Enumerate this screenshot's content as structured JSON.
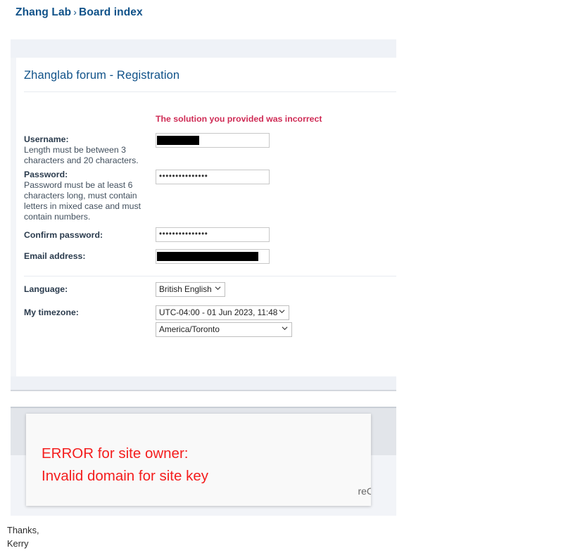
{
  "breadcrumb": {
    "root": "Zhang Lab",
    "separator": "›",
    "current": "Board index"
  },
  "registration_panel": {
    "title": "Zhanglab forum - Registration",
    "error_message": "The solution you provided was incorrect",
    "fields": [
      {
        "label": "Username:",
        "help": "Length must be between 3 characters and 20 characters.",
        "value": "",
        "redacted": true
      },
      {
        "label": "Password:",
        "help": "Password must be at least 6 characters long, must contain letters in mixed case and must contain numbers.",
        "value": "•••••••••••••••",
        "redacted": false
      },
      {
        "label": "Confirm password:",
        "help": "",
        "value": "•••••••••••••••",
        "redacted": false
      },
      {
        "label": "Email address:",
        "help": "",
        "value": "",
        "redacted": true
      }
    ],
    "preferences": {
      "language_label": "Language:",
      "language_value": "British English",
      "timezone_label": "My timezone:",
      "timezone_value": "UTC-04:00 - 01 Jun 2023, 11:48",
      "timezone_region_value": "America/Toronto"
    }
  },
  "recaptcha": {
    "error_line_1": "ERROR for site owner:",
    "error_line_2": "Invalid domain for site key",
    "brand_text": "reC",
    "error_color": "#f41d1d"
  },
  "signature": {
    "closing": "Thanks,",
    "name": "Kerry"
  }
}
